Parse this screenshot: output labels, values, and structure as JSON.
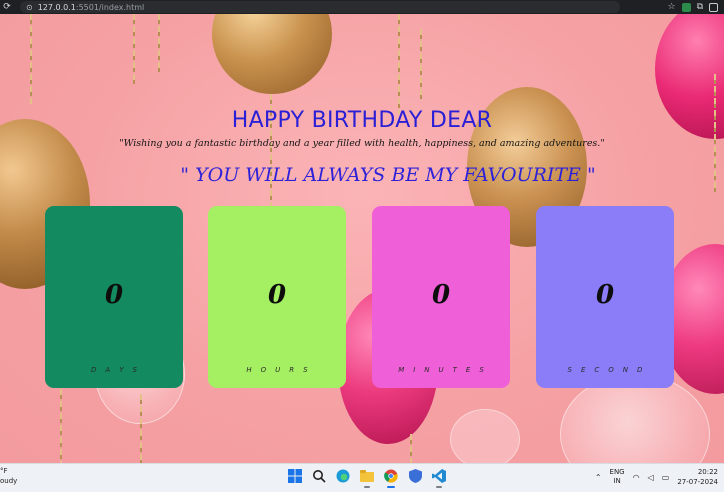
{
  "browser": {
    "url_host": "127.0.0.1",
    "url_rest": ":5501/index.html"
  },
  "page": {
    "title": "HAPPY BIRTHDAY DEAR",
    "subtitle": "\"Wishing you a fantastic birthday and a year filled with health, happiness, and amazing adventures.\"",
    "quote": "\" YOU WILL ALWAYS BE MY FAVOURITE \""
  },
  "countdown": [
    {
      "value": "0",
      "label": "DAYS"
    },
    {
      "value": "0",
      "label": "HOURS"
    },
    {
      "value": "0",
      "label": "MINUTES"
    },
    {
      "value": "0",
      "label": "SECOND"
    }
  ],
  "taskbar": {
    "weather_temp": "°F",
    "weather_text": "oudy",
    "lang_top": "ENG",
    "lang_bottom": "IN",
    "time": "20:22",
    "date": "27-07-2024"
  },
  "colors": {
    "days": "#138a5f",
    "hours": "#a4ef62",
    "minutes": "#ef5fd8",
    "second": "#8b7df8",
    "title": "#2a1fd6"
  }
}
